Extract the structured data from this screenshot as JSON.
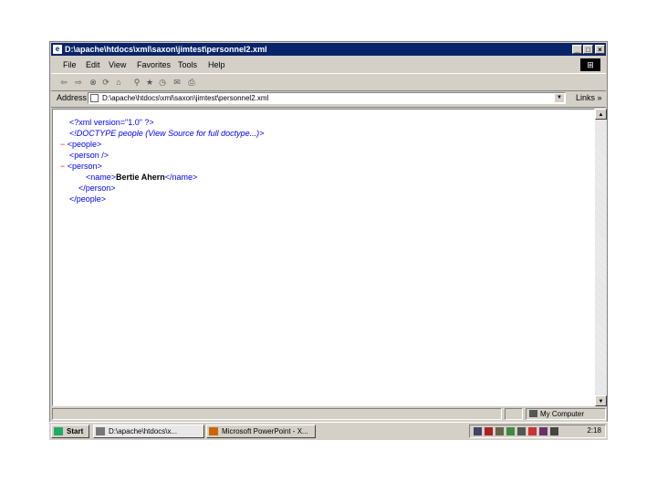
{
  "window": {
    "title": "D:\\apache\\htdocs\\xml\\saxon\\jimtest\\personnel2.xml",
    "controls": [
      "_",
      "□",
      "×"
    ]
  },
  "menu": [
    "File",
    "Edit",
    "View",
    "Favorites",
    "Tools",
    "Help"
  ],
  "toolbar": {
    "icons": [
      "back-icon",
      "forward-icon",
      "stop-icon",
      "refresh-icon",
      "home-icon",
      "search-icon",
      "favorites-icon",
      "history-icon",
      "mail-icon",
      "print-icon"
    ]
  },
  "address": {
    "label": "Address",
    "value": "D:\\apache\\htdocs\\xml\\saxon\\jimtest\\personnel2.xml",
    "links_label": "Links »"
  },
  "xml_lines": [
    {
      "prefix": "",
      "text": "<?xml version=\"1.0\" ?>",
      "style": "blue"
    },
    {
      "prefix": "",
      "text": "<!DOCTYPE people (View Source for full doctype...)>",
      "style": "dtd"
    },
    {
      "prefix": "−",
      "text": "<people>",
      "style": "blue"
    },
    {
      "prefix": "",
      "text": "<person />",
      "style": "blue"
    },
    {
      "prefix": "−",
      "text": "<person>",
      "style": "blue"
    },
    {
      "prefix": "",
      "text": "<name>",
      "style": "blue",
      "bold": "Bertie Ahern",
      "tail": "</name>"
    },
    {
      "prefix": "",
      "text": "</person>",
      "style": "blue"
    },
    {
      "prefix": "",
      "text": "</people>",
      "style": "blue"
    }
  ],
  "status": {
    "left": "",
    "zone": "My Computer"
  },
  "taskbar": {
    "start": "Start",
    "buttons": [
      "D:\\apache\\htdocs\\x...",
      "Microsoft PowerPoint - X..."
    ],
    "clock": "2:18"
  },
  "colors": {
    "titlebar": "#0a246a",
    "chrome": "#d4d0c8",
    "xml_tag": "#0000ff",
    "minus": "#ff0000"
  }
}
